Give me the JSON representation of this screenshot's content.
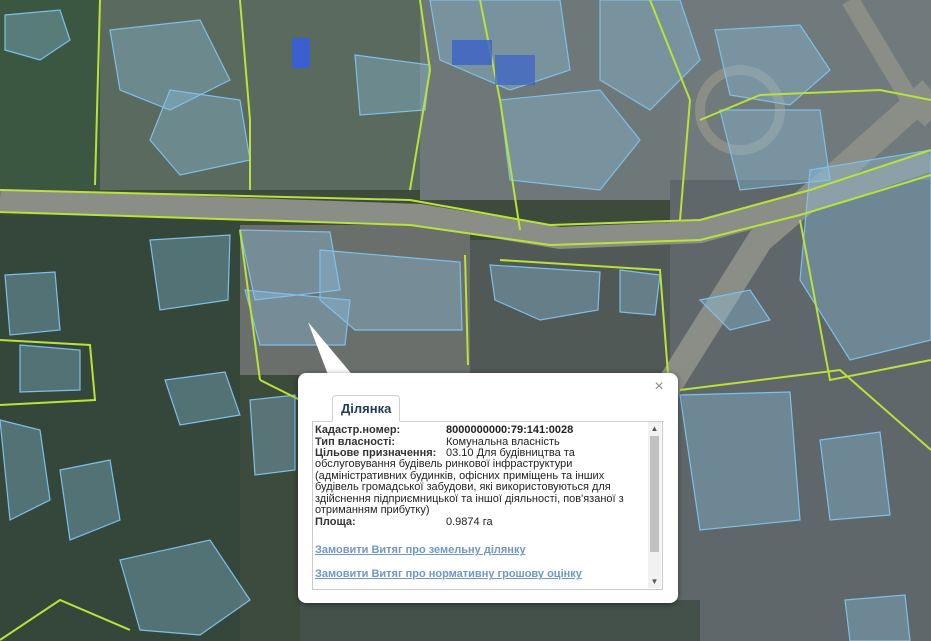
{
  "map": {
    "imagery_colors": {
      "base": "#3d4b3c",
      "road": "#8a8e86",
      "parcel_fill": "#8cc4e6",
      "parcel_stroke": "#7fbfe8",
      "boundary": "#b9e23a"
    }
  },
  "popup": {
    "tab_label": "Ділянка",
    "close_symbol": "×",
    "fields": [
      {
        "key": "Кадастр.номер:",
        "value": "8000000000:79:141:0028"
      },
      {
        "key": "Тип власності:",
        "value": "Комунальна власність"
      }
    ],
    "purpose_label": "Цільове призначення:",
    "purpose_value": "03.10 Для будівництва та обслуговування будівель ринкової інфраструктури (адміністративних будинків, офісних приміщень та інших будівель громадської забудови, які використовуються для здійснення підприємницької та іншої діяльності, пов'язаної з отриманням прибутку)",
    "area_label": "Площа:",
    "area_value": "0.9874 га",
    "links": [
      "Замовити Витяг про земельну ділянку",
      "Замовити Витяг про нормативну грошову оцінку"
    ]
  }
}
